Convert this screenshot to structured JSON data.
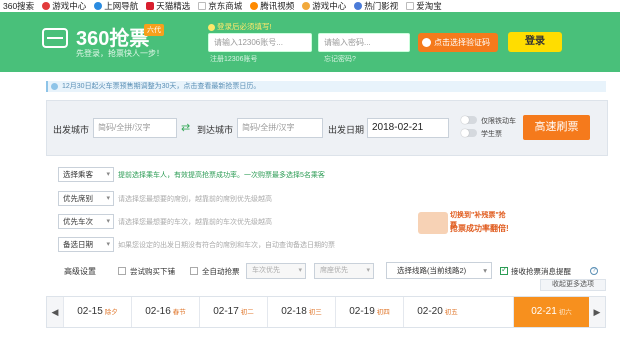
{
  "bookmarks": [
    {
      "label": "360搜索",
      "color": "#ffffff"
    },
    {
      "label": "游戏中心",
      "color": "#e23b3b"
    },
    {
      "label": "上网导航",
      "color": "#2a8be0"
    },
    {
      "label": "天猫精选",
      "color": "#d81e2e"
    },
    {
      "label": "京东商城",
      "color": "#dddddd"
    },
    {
      "label": "腾讯视频",
      "color": "#ff8a00"
    },
    {
      "label": "游戏中心",
      "color": "#f2a93b"
    },
    {
      "label": "热门影视",
      "color": "#4a7bd8"
    },
    {
      "label": "爱淘宝",
      "color": "#dddddd"
    }
  ],
  "header": {
    "logo_text": "360抢票",
    "logo_badge": "六代",
    "slogan": "先登录，抢票快人一步！",
    "login_tip": "登录后必须填写!",
    "username_placeholder": "请输入12306账号...",
    "password_placeholder": "请输入密码...",
    "register_link": "注册12306账号",
    "forgot_link": "忘记密码?",
    "captcha_button": "点击选择验证码",
    "login_button": "登录"
  },
  "notice": "12月30日起火车票预售期调整为30天，点击查看最新抢票日历。",
  "search": {
    "from_label": "出发城市",
    "from_placeholder": "简码/全拼/汉字",
    "to_label": "到达城市",
    "to_placeholder": "简码/全拼/汉字",
    "date_label": "出发日期",
    "date_value": "2018-02-21",
    "toggle_1": "仅限铁动车",
    "toggle_2": "学生票",
    "search_button": "高速刷票"
  },
  "options": [
    {
      "select": "选择乘客",
      "hint": "提前选择乘车人，有效提高抢票成功率。一次购票最多选择5名乘客",
      "green": true
    },
    {
      "select": "优先席别",
      "hint": "请选择您最想要的席别，越靠前的席别优先级越高",
      "green": false
    },
    {
      "select": "优先车次",
      "hint": "请选择您最想要的车次，越靠前的车次优先级越高",
      "green": false
    },
    {
      "select": "备选日期",
      "hint": "如果您设定的出发日期没有符合的席别和车次，自动查询备选日期的票",
      "green": false
    }
  ],
  "promo": {
    "line1": "切换到\"补残票\"抢票",
    "line2": "抢票成功率翻倍!"
  },
  "advanced": {
    "label": "高级设置",
    "cb1": "尝试购买下铺",
    "cb2": "全自动抢票",
    "select1": "车次优先",
    "select2": "席座优先",
    "route_button": "选择线路(当前线路2)",
    "cb3": "接收抢票消息提醒",
    "help": "?",
    "collapse": "收起更多选项"
  },
  "dates": [
    {
      "d": "02-15",
      "s": "除夕"
    },
    {
      "d": "02-16",
      "s": "春节"
    },
    {
      "d": "02-17",
      "s": "初二"
    },
    {
      "d": "02-18",
      "s": "初三"
    },
    {
      "d": "02-19",
      "s": "初四"
    },
    {
      "d": "02-20",
      "s": "初五"
    },
    {
      "d": "02-21",
      "s": "初六"
    }
  ],
  "date_nav": {
    "prev": "◀",
    "next": "▶"
  },
  "colors": {
    "brand_green": "#49c07a",
    "accent_orange": "#f57a1c",
    "login_yellow": "#ffdd00"
  }
}
